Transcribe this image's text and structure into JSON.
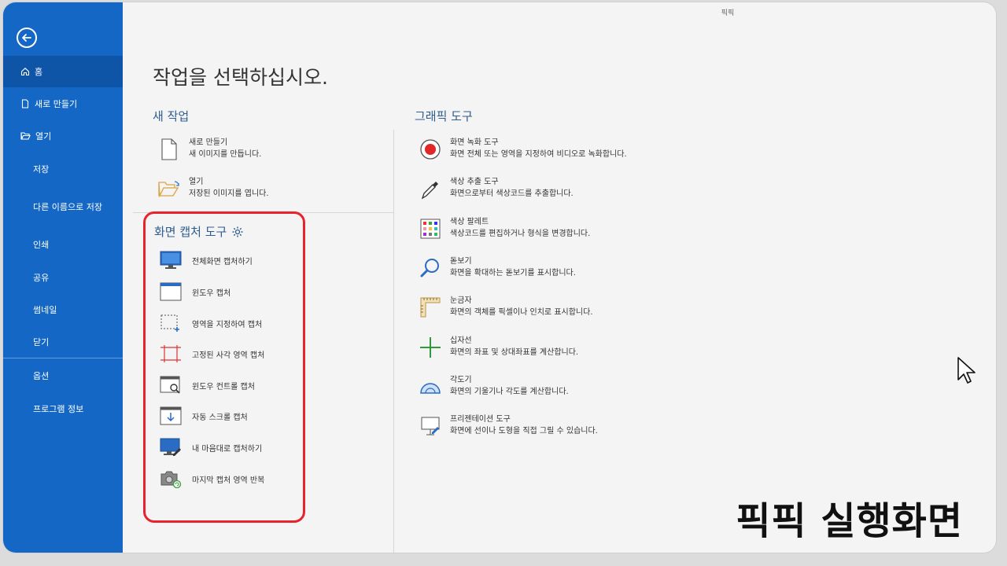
{
  "window": {
    "title": "픽픽"
  },
  "sidebar": {
    "items": [
      {
        "label": "홈",
        "icon": "home-icon"
      },
      {
        "label": "새로 만들기",
        "icon": "new-file-icon"
      },
      {
        "label": "열기",
        "icon": "folder-open-icon"
      },
      {
        "label": "저장"
      },
      {
        "label": "다른 이름으로 저장"
      },
      {
        "label": "인쇄"
      },
      {
        "label": "공유"
      },
      {
        "label": "썸네일"
      },
      {
        "label": "닫기"
      },
      {
        "label": "옵션"
      },
      {
        "label": "프로그램 정보"
      }
    ]
  },
  "main": {
    "title": "작업을 선택하십시오.",
    "new_task": {
      "heading": "새 작업",
      "items": [
        {
          "title": "새로 만들기",
          "desc": "새 이미지를 만듭니다."
        },
        {
          "title": "열기",
          "desc": "저장된 이미지를 엽니다."
        }
      ]
    },
    "capture": {
      "heading": "화면 캡처 도구",
      "items": [
        {
          "label": "전체화면 캡처하기"
        },
        {
          "label": "윈도우 캡처"
        },
        {
          "label": "영역을 지정하여 캡처"
        },
        {
          "label": "고정된 사각 영역 캡처"
        },
        {
          "label": "윈도우 컨트롤 캡처"
        },
        {
          "label": "자동 스크롤 캡처"
        },
        {
          "label": "내 마음대로 캡처하기"
        },
        {
          "label": "마지막 캡처 영역 반복"
        }
      ]
    },
    "graphic": {
      "heading": "그래픽 도구",
      "items": [
        {
          "title": "화면 녹화 도구",
          "desc": "화면 전체 또는 영역을 지정하여 비디오로 녹화합니다."
        },
        {
          "title": "색상 추출 도구",
          "desc": "화면으로부터 색상코드를 추출합니다."
        },
        {
          "title": "색상 팔레트",
          "desc": "색상코드를 편집하거나 형식을 변경합니다."
        },
        {
          "title": "돋보기",
          "desc": "화면을 확대하는 돋보기를 표시합니다."
        },
        {
          "title": "눈금자",
          "desc": "화면의 객체를 픽셀이나 인치로 표시합니다."
        },
        {
          "title": "십자선",
          "desc": "화면의 좌표 및 상대좌표를 계산합니다."
        },
        {
          "title": "각도기",
          "desc": "화면의 기울기나 각도를 계산합니다."
        },
        {
          "title": "프리젠테이션 도구",
          "desc": "화면에 선이나 도형을 직접 그릴 수 있습니다."
        }
      ]
    }
  },
  "overlay_caption": "픽픽 실행화면",
  "colors": {
    "sidebar": "#1467c4",
    "accent": "#2f5d8f",
    "highlight": "#e8232d"
  }
}
